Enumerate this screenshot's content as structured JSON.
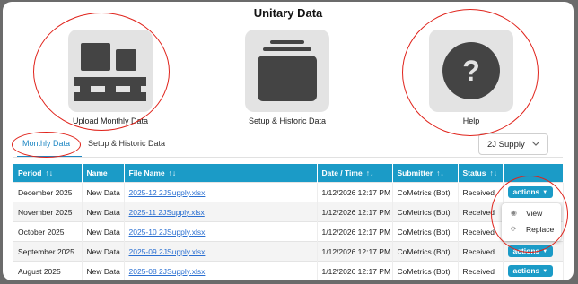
{
  "page": {
    "title": "Unitary Data"
  },
  "cards": [
    {
      "label": "Upload Monthly Data",
      "icon": "upload-layout-icon"
    },
    {
      "label": "Setup & Historic Data",
      "icon": "stack-tray-icon"
    },
    {
      "label": "Help",
      "icon": "question-mark-icon"
    }
  ],
  "tabs": [
    {
      "label": "Monthly Data"
    },
    {
      "label": "Setup & Historic Data"
    }
  ],
  "supply_select": {
    "value": "2J Supply"
  },
  "table": {
    "columns": [
      "Period",
      "Name",
      "File Name",
      "Date / Time",
      "Submitter",
      "Status",
      ""
    ],
    "sort_icon": "↑↓",
    "rows": [
      {
        "period": "December 2025",
        "name": "New Data",
        "file": "2025-12 2JSupply.xlsx",
        "datetime": "1/12/2026 12:17 PM",
        "submitter": "CoMetrics (Bot)",
        "status": "Received",
        "action": "actions"
      },
      {
        "period": "November 2025",
        "name": "New Data",
        "file": "2025-11 2JSupply.xlsx",
        "datetime": "1/12/2026 12:17 PM",
        "submitter": "CoMetrics (Bot)",
        "status": "Received",
        "action": ""
      },
      {
        "period": "October 2025",
        "name": "New Data",
        "file": "2025-10 2JSupply.xlsx",
        "datetime": "1/12/2026 12:17 PM",
        "submitter": "CoMetrics (Bot)",
        "status": "Received",
        "action": ""
      },
      {
        "period": "September 2025",
        "name": "New Data",
        "file": "2025-09 2JSupply.xlsx",
        "datetime": "1/12/2026 12:17 PM",
        "submitter": "CoMetrics (Bot)",
        "status": "Received",
        "action": "actions"
      },
      {
        "period": "August 2025",
        "name": "New Data",
        "file": "2025-08 2JSupply.xlsx",
        "datetime": "1/12/2026 12:17 PM",
        "submitter": "CoMetrics (Bot)",
        "status": "Received",
        "action": "actions"
      }
    ]
  },
  "actions_menu": {
    "items": [
      {
        "label": "View",
        "icon": "eye-icon"
      },
      {
        "label": "Replace",
        "icon": "replace-icon"
      }
    ]
  },
  "colors": {
    "accent": "#1b9bc7",
    "link": "#2a6fd1",
    "annotation": "#e0231b"
  }
}
